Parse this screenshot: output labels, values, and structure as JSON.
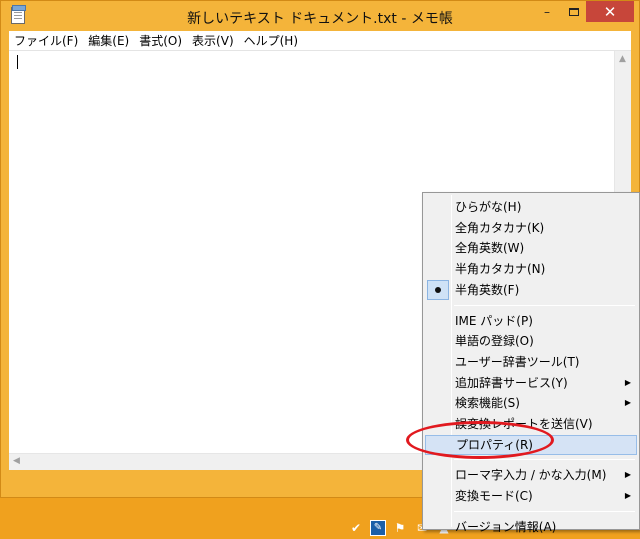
{
  "window": {
    "title": "新しいテキスト ドキュメント.txt - メモ帳",
    "controls": {
      "minimize": "–",
      "close": "✕"
    }
  },
  "menubar": [
    "ファイル(F)",
    "編集(E)",
    "書式(O)",
    "表示(V)",
    "ヘルプ(H)"
  ],
  "editor": {
    "content": ""
  },
  "context_menu": {
    "groups": [
      [
        {
          "label": "ひらがな(H)",
          "checked": false,
          "submenu": false
        },
        {
          "label": "全角カタカナ(K)",
          "checked": false,
          "submenu": false
        },
        {
          "label": "全角英数(W)",
          "checked": false,
          "submenu": false
        },
        {
          "label": "半角カタカナ(N)",
          "checked": false,
          "submenu": false
        },
        {
          "label": "半角英数(F)",
          "checked": true,
          "submenu": false
        }
      ],
      [
        {
          "label": "IME パッド(P)",
          "checked": false,
          "submenu": false
        },
        {
          "label": "単語の登録(O)",
          "checked": false,
          "submenu": false
        },
        {
          "label": "ユーザー辞書ツール(T)",
          "checked": false,
          "submenu": false
        },
        {
          "label": "追加辞書サービス(Y)",
          "checked": false,
          "submenu": true
        },
        {
          "label": "検索機能(S)",
          "checked": false,
          "submenu": true
        },
        {
          "label": "誤変換レポートを送信(V)",
          "checked": false,
          "submenu": false
        },
        {
          "label": "プロパティ(R)",
          "checked": false,
          "submenu": false,
          "highlighted": true
        }
      ],
      [
        {
          "label": "ローマ字入力 / かな入力(M)",
          "checked": false,
          "submenu": true
        },
        {
          "label": "変換モード(C)",
          "checked": false,
          "submenu": true
        }
      ],
      [
        {
          "label": "バージョン情報(A)",
          "checked": false,
          "submenu": false
        }
      ]
    ],
    "highlight_color": "#d5e3f5",
    "annotation_color": "#e1191f"
  },
  "tray": {
    "icons": [
      "check-flag-icon",
      "ime-tool-icon",
      "flag-icon",
      "notification-icon",
      "up-arrow-icon"
    ]
  },
  "colors": {
    "window_frame": "#f4b43a",
    "desktop": "#f0a11e",
    "close_button": "#c7463a"
  }
}
